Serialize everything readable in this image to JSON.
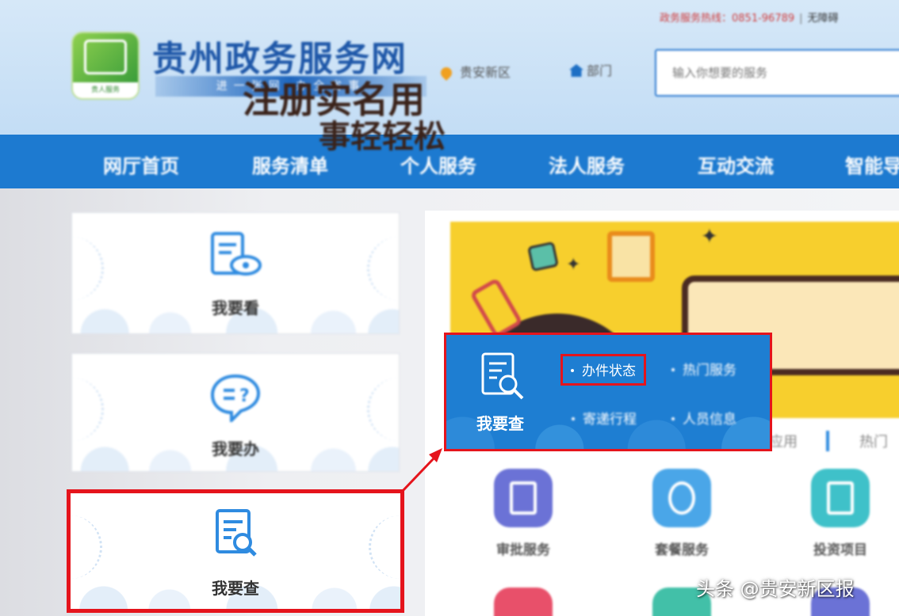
{
  "header": {
    "hotline": "政务服务热线：0851-96789",
    "hotline_tail": "无障碍",
    "logo_text": "贵人服务",
    "site_title": "贵州政务服务网",
    "slogan": "进一张网 办全省事",
    "location": "贵安新区",
    "department": "部门",
    "search_placeholder": "输入你想要的服务"
  },
  "nav": {
    "items": [
      "网厅首页",
      "服务清单",
      "个人服务",
      "法人服务",
      "互动交流",
      "智能导"
    ]
  },
  "left_cards": {
    "kan": "我要看",
    "ban": "我要办",
    "cha": "我要查"
  },
  "banner": {
    "line1": "注册实名用",
    "line2": "事轻轻松"
  },
  "tabs": {
    "left": "应用",
    "right": "热门"
  },
  "services": [
    {
      "name": "审批服务",
      "color": "#6b72d6"
    },
    {
      "name": "套餐服务",
      "color": "#4aa6e8"
    },
    {
      "name": "投资项目",
      "color": "#3fc1c9"
    }
  ],
  "popup": {
    "title": "我要查",
    "links": [
      "办件状态",
      "热门服务",
      "寄递行程",
      "人员信息"
    ],
    "highlight_color": "#e5141c"
  },
  "watermark": "头条 @贵安新区报"
}
